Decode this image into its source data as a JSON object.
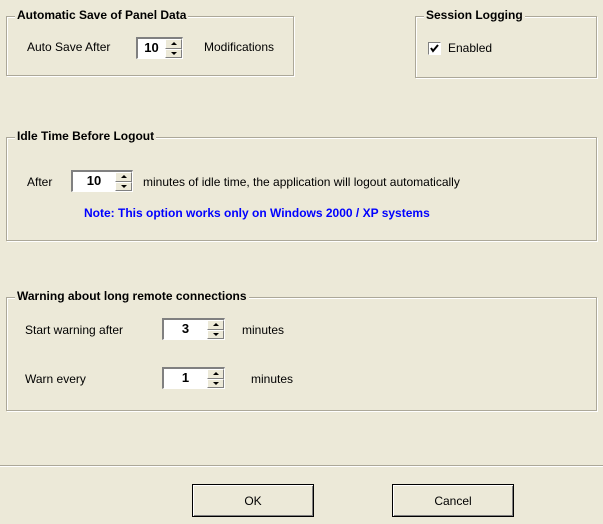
{
  "auto_save": {
    "legend": "Automatic Save of Panel Data",
    "label_before": "Auto Save After",
    "value": "10",
    "label_after": "Modifications"
  },
  "session_logging": {
    "legend": "Session Logging",
    "checkbox_label": "Enabled",
    "checked": true
  },
  "idle": {
    "legend": "Idle Time Before Logout",
    "label_before": "After",
    "value": "10",
    "label_after": "minutes of idle time, the application will logout automatically",
    "note": "Note: This option works only on Windows 2000 / XP systems"
  },
  "warning": {
    "legend": "Warning about long remote connections",
    "start_label": "Start warning after",
    "start_value": "3",
    "start_unit": "minutes",
    "every_label": "Warn every",
    "every_value": "1",
    "every_unit": "minutes"
  },
  "buttons": {
    "ok": "OK",
    "cancel": "Cancel"
  },
  "colors": {
    "background": "#ece9d8",
    "note": "#0000ff"
  }
}
